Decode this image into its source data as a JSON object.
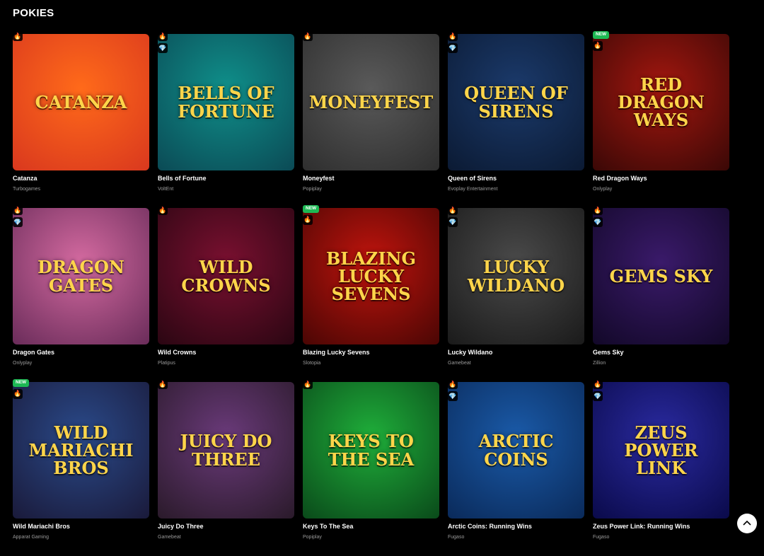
{
  "section": {
    "title": "POKIES"
  },
  "games": [
    {
      "name": "Catanza",
      "provider": "Turbogames",
      "art_text": "Catanza",
      "badges": [
        "fire-icon"
      ],
      "colors": [
        "#ff6a1a",
        "#d9381e"
      ]
    },
    {
      "name": "Bells of Fortune",
      "provider": "VoltEnt",
      "art_text": "Bells of Fortune",
      "badges": [
        "fire-icon",
        "gem-icon"
      ],
      "colors": [
        "#0f8f8a",
        "#0b4a55"
      ]
    },
    {
      "name": "Moneyfest",
      "provider": "Popiplay",
      "art_text": "Moneyfest",
      "badges": [
        "fire-icon"
      ],
      "colors": [
        "#5a5a5a",
        "#2e2e2e"
      ]
    },
    {
      "name": "Queen of Sirens",
      "provider": "Evoplay Entertainment",
      "art_text": "Queen of Sirens",
      "badges": [
        "fire-icon",
        "gem-icon"
      ],
      "colors": [
        "#1b3a6b",
        "#0b1a33"
      ]
    },
    {
      "name": "Red Dragon Ways",
      "provider": "Onlyplay",
      "art_text": "Red Dragon Ways",
      "badges": [
        "new-badge",
        "fire-icon"
      ],
      "new_label": "NEW",
      "colors": [
        "#a3170f",
        "#3a0806"
      ]
    },
    {
      "name": "Dragon Gates",
      "provider": "Onlyplay",
      "art_text": "Dragon Gates",
      "badges": [
        "fire-icon",
        "gem-icon"
      ],
      "colors": [
        "#d46aa0",
        "#6a2c5a"
      ]
    },
    {
      "name": "Wild Crowns",
      "provider": "Platipus",
      "art_text": "Wild Crowns",
      "badges": [
        "fire-icon"
      ],
      "colors": [
        "#7a1030",
        "#2a0612"
      ]
    },
    {
      "name": "Blazing Lucky Sevens",
      "provider": "Slotopia",
      "art_text": "Blazing Lucky Sevens",
      "badges": [
        "new-badge",
        "fire-icon"
      ],
      "new_label": "NEW",
      "colors": [
        "#c0140d",
        "#4a0604"
      ]
    },
    {
      "name": "Lucky Wildano",
      "provider": "Gamebeat",
      "art_text": "Lucky Wildano",
      "badges": [
        "fire-icon",
        "gem-icon"
      ],
      "colors": [
        "#4a4a4a",
        "#1a1a1a"
      ]
    },
    {
      "name": "Gems Sky",
      "provider": "Zillion",
      "art_text": "Gems Sky",
      "badges": [
        "fire-icon",
        "gem-icon"
      ],
      "colors": [
        "#3a1a6a",
        "#120828"
      ]
    },
    {
      "name": "Wild Mariachi Bros",
      "provider": "Apparat Gaming",
      "art_text": "Wild Mariachi Bros",
      "badges": [
        "new-badge",
        "fire-icon"
      ],
      "new_label": "NEW",
      "colors": [
        "#2a4a8a",
        "#1a1a3a"
      ]
    },
    {
      "name": "Juicy Do Three",
      "provider": "Gamebeat",
      "art_text": "Juicy Do Three",
      "badges": [
        "fire-icon"
      ],
      "colors": [
        "#6a3a7a",
        "#2a1a2a"
      ]
    },
    {
      "name": "Keys To The Sea",
      "provider": "Popiplay",
      "art_text": "Keys to the Sea",
      "badges": [
        "fire-icon"
      ],
      "colors": [
        "#1fae3a",
        "#0a4a1a"
      ]
    },
    {
      "name": "Arctic Coins: Running Wins",
      "provider": "Fugaso",
      "art_text": "Arctic Coins",
      "badges": [
        "fire-icon",
        "gem-icon"
      ],
      "colors": [
        "#1a5aa8",
        "#0a2a5a"
      ]
    },
    {
      "name": "Zeus Power Link: Running Wins",
      "provider": "Fugaso",
      "art_text": "Zeus Power Link",
      "badges": [
        "fire-icon",
        "gem-icon"
      ],
      "colors": [
        "#2a2aa0",
        "#0a0a4a"
      ]
    }
  ],
  "icons": {
    "fire": "🔥",
    "gem": "💎"
  },
  "scroll_top": {
    "icon": "chevron-up-icon"
  }
}
